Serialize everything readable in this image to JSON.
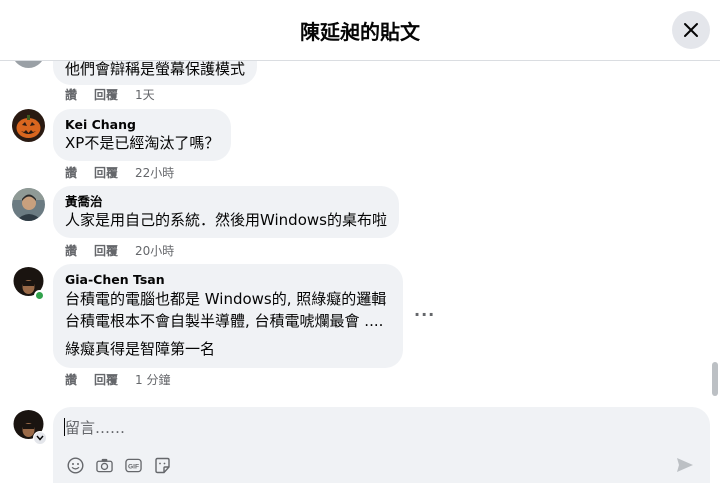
{
  "header": {
    "title": "陳延昶的貼文"
  },
  "comments": [
    {
      "body": [
        "他們會辯稱是螢幕保護模式"
      ],
      "actions": {
        "like": "讚",
        "reply": "回覆",
        "time": "1天"
      }
    },
    {
      "author": "Kei Chang",
      "body": [
        "XP不是已經淘汰了嗎？"
      ],
      "actions": {
        "like": "讚",
        "reply": "回覆",
        "time": "22小時"
      }
    },
    {
      "author": "黃喬治",
      "body": [
        "人家是用自己的系統．然後用Windows的桌布啦"
      ],
      "actions": {
        "like": "讚",
        "reply": "回覆",
        "time": "20小時"
      }
    },
    {
      "author": "Gia-Chen Tsan",
      "body": [
        "台積電的電腦也都是 Windows的, 照綠癡的邏輯",
        "台積電根本不會自製半導體, 台積電唬爛最會 ....",
        "綠癡真得是智障第一名"
      ],
      "actions": {
        "like": "讚",
        "reply": "回覆",
        "time": "1 分鐘"
      },
      "more": "···"
    }
  ],
  "composer": {
    "placeholder": "留言……"
  },
  "icons": {
    "close": "close-icon",
    "emoji": "emoji-icon",
    "camera": "camera-icon",
    "gif": "gif-icon",
    "sticker": "sticker-icon",
    "send": "send-icon"
  },
  "colors": {
    "bubble": "#f0f2f5",
    "meta_text": "#65676b",
    "online": "#31a24c"
  }
}
